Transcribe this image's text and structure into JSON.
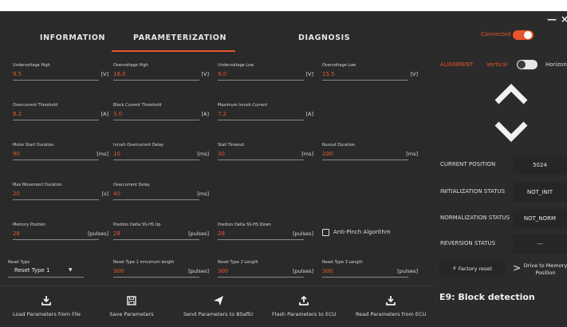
{
  "window": {
    "minimize": "—",
    "close": "×"
  },
  "tabs": [
    {
      "label": "INFORMATION"
    },
    {
      "label": "PARAMETERIZATION"
    },
    {
      "label": "DIAGNOSIS"
    }
  ],
  "fields": [
    {
      "label": "Undervoltage High",
      "value": "9.5",
      "unit": "[V]"
    },
    {
      "label": "Overvoltage High",
      "value": "16.0",
      "unit": "[V]"
    },
    {
      "label": "Undervoltage Low",
      "value": "9.0",
      "unit": "[V]"
    },
    {
      "label": "Overvoltage Low",
      "value": "15.5",
      "unit": "[V]"
    },
    {
      "label": "Overcurrent Threshold",
      "value": "8.2",
      "unit": "[A]"
    },
    {
      "label": "Block Current Threshold",
      "value": "3.0",
      "unit": "[A]"
    },
    {
      "label": "Maximum Inrush Current",
      "value": "7.2",
      "unit": "[A]"
    },
    {
      "label": "Motor Start Duration",
      "value": "90",
      "unit": "[ms]"
    },
    {
      "label": "Inrush Overcurrent Delay",
      "value": "10",
      "unit": "[ms]"
    },
    {
      "label": "Stall Timeout",
      "value": "30",
      "unit": "[ms]"
    },
    {
      "label": "Runout Duration",
      "value": "200",
      "unit": "[ms]"
    },
    {
      "label": "Max Movement Duration",
      "value": "20",
      "unit": "[s]"
    },
    {
      "label": "Overcurrent Delay",
      "value": "40",
      "unit": "[ms]"
    },
    {
      "label": "Memory Position",
      "value": "28",
      "unit": "[pulses]"
    },
    {
      "label": "Position Delta SS-HS Up",
      "value": "28",
      "unit": "[pulses]"
    },
    {
      "label": "Position Delta SS-HS Down",
      "value": "28",
      "unit": "[pulses]"
    },
    {
      "label": "Reset Type 1 minumum length",
      "value": "300",
      "unit": "[pulses]"
    },
    {
      "label": "Reset Type 2 Length",
      "value": "300",
      "unit": "[pulses]"
    },
    {
      "label": "Reset Type 3 Length",
      "value": "300",
      "unit": "[pulses]"
    }
  ],
  "anti_pinch": {
    "label": "Anti-Pinch Algorithm"
  },
  "reset_type": {
    "label": "Reset Type",
    "selected": "Reset Type 1"
  },
  "bottom_buttons": [
    {
      "label": "Load Parameters from File",
      "icon": "download-icon"
    },
    {
      "label": "Save Parameters",
      "icon": "save-icon"
    },
    {
      "label": "Send Parameters to BSafEr",
      "icon": "send-icon"
    },
    {
      "label": "Flash Parameters to ECU",
      "icon": "upload-icon"
    },
    {
      "label": "Read Parameters from ECU",
      "icon": "download-icon"
    }
  ],
  "right": {
    "connected": "Connected",
    "alignment_label": "ALIGNMENT",
    "vertical_label": "Vertical",
    "horizontal_label": "Horizontal",
    "status": [
      {
        "label": "CURRENT POSITION",
        "value": "5024"
      },
      {
        "label": "INITIALIZATION STATUS",
        "value": "NOT_INIT"
      },
      {
        "label": "NORMALIZATION STATUS",
        "value": "NOT_NORM"
      },
      {
        "label": "REVERSION STATUS",
        "value": "---"
      }
    ],
    "factory_reset": "Factory reset",
    "drive_to_memory": "Drive to Memory Position",
    "error": "E9: Block detection"
  },
  "colors": {
    "accent": "#e8552a",
    "bg": "#2a2a2a",
    "text": "#dddddd"
  }
}
